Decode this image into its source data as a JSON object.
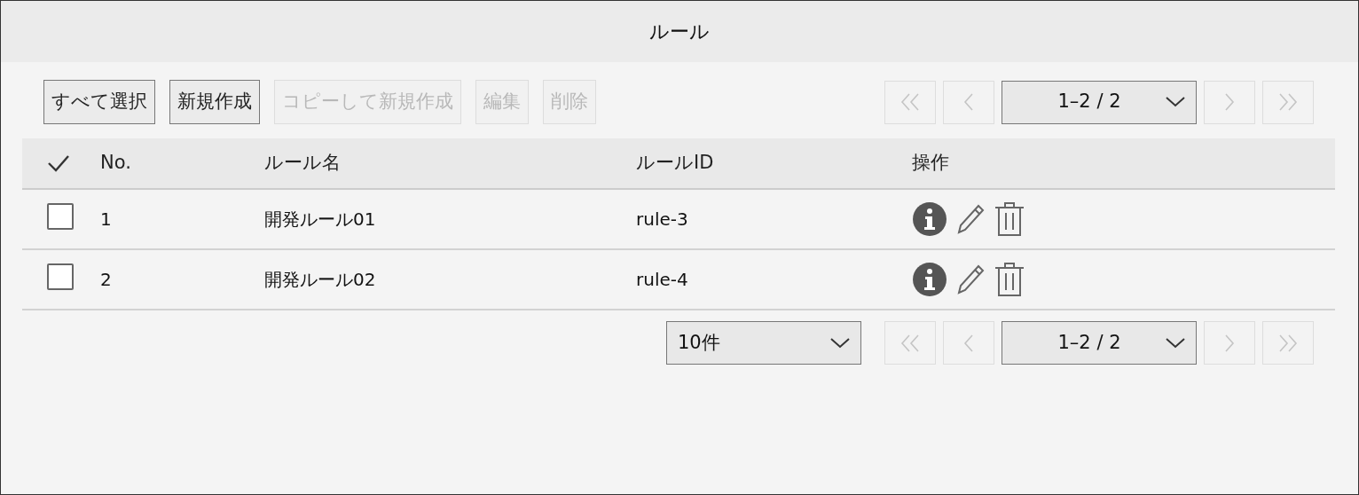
{
  "window": {
    "title": "ルール"
  },
  "toolbar": [
    {
      "label": "すべて選択",
      "disabled": false
    },
    {
      "label": "新規作成",
      "disabled": false
    },
    {
      "label": "コピーして新規作成",
      "disabled": true
    },
    {
      "label": "編集",
      "disabled": true
    },
    {
      "label": "削除",
      "disabled": true
    }
  ],
  "pager_top": {
    "value": "1–2 / 2",
    "nav": [
      {
        "kind": "first",
        "disabled": true
      },
      {
        "kind": "prev",
        "disabled": true
      },
      {
        "kind": "next",
        "disabled": true
      },
      {
        "kind": "last",
        "disabled": true
      }
    ]
  },
  "table": {
    "columns": [
      "No.",
      "ルール名",
      "ルールID",
      "操作"
    ],
    "rows": [
      {
        "checked": false,
        "no": "1",
        "name": "開発ルール01",
        "id": "rule-3"
      },
      {
        "checked": false,
        "no": "2",
        "name": "開発ルール02",
        "id": "rule-4"
      }
    ]
  },
  "page_size": "10件",
  "pager_bottom": {
    "value": "1–2 / 2",
    "nav": [
      {
        "kind": "first",
        "disabled": true
      },
      {
        "kind": "prev",
        "disabled": true
      },
      {
        "kind": "next",
        "disabled": true
      },
      {
        "kind": "last",
        "disabled": true
      }
    ]
  }
}
